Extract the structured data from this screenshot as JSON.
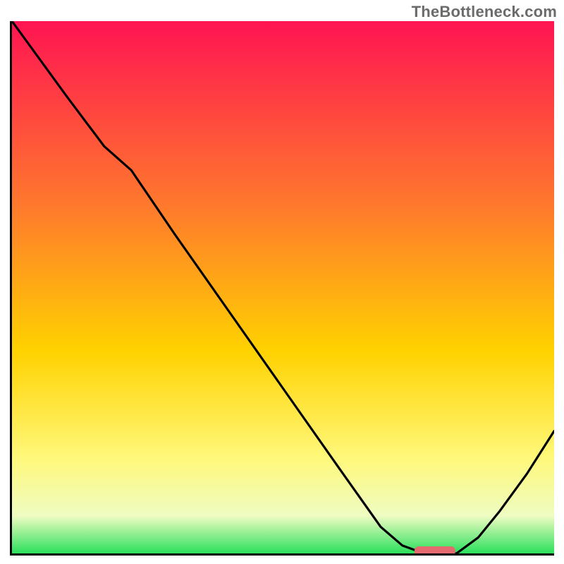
{
  "watermark": "TheBottleneck.com",
  "colors": {
    "gradient_top": "#ff1452",
    "gradient_mid_upper": "#ff7a2c",
    "gradient_mid": "#ffd200",
    "gradient_mid_lower": "#fff87a",
    "gradient_lower": "#eefcc2",
    "gradient_bottom": "#2ae05c",
    "curve": "#000000",
    "marker": "#e46a6f"
  },
  "chart_data": {
    "type": "line",
    "title": "",
    "xlabel": "",
    "ylabel": "",
    "xlim": [
      0,
      100
    ],
    "ylim": [
      0,
      100
    ],
    "series": [
      {
        "name": "bottleneck-curve",
        "x": [
          0,
          5,
          10,
          17,
          22,
          30,
          40,
          50,
          60,
          68,
          72,
          76,
          78,
          82,
          86,
          90,
          95,
          100
        ],
        "values": [
          100,
          93,
          86,
          76.5,
          72,
          60,
          45.5,
          31,
          16.5,
          5,
          1.5,
          0,
          0,
          0,
          3,
          8,
          15,
          23
        ]
      }
    ],
    "annotations": [
      {
        "name": "optimal-marker",
        "x": 78,
        "y": 0,
        "shape": "rounded-bar"
      }
    ],
    "notes": "No axis ticks or numeric labels are rendered; y encoded as bottleneck %. Background is a red→yellow→green vertical gradient."
  }
}
